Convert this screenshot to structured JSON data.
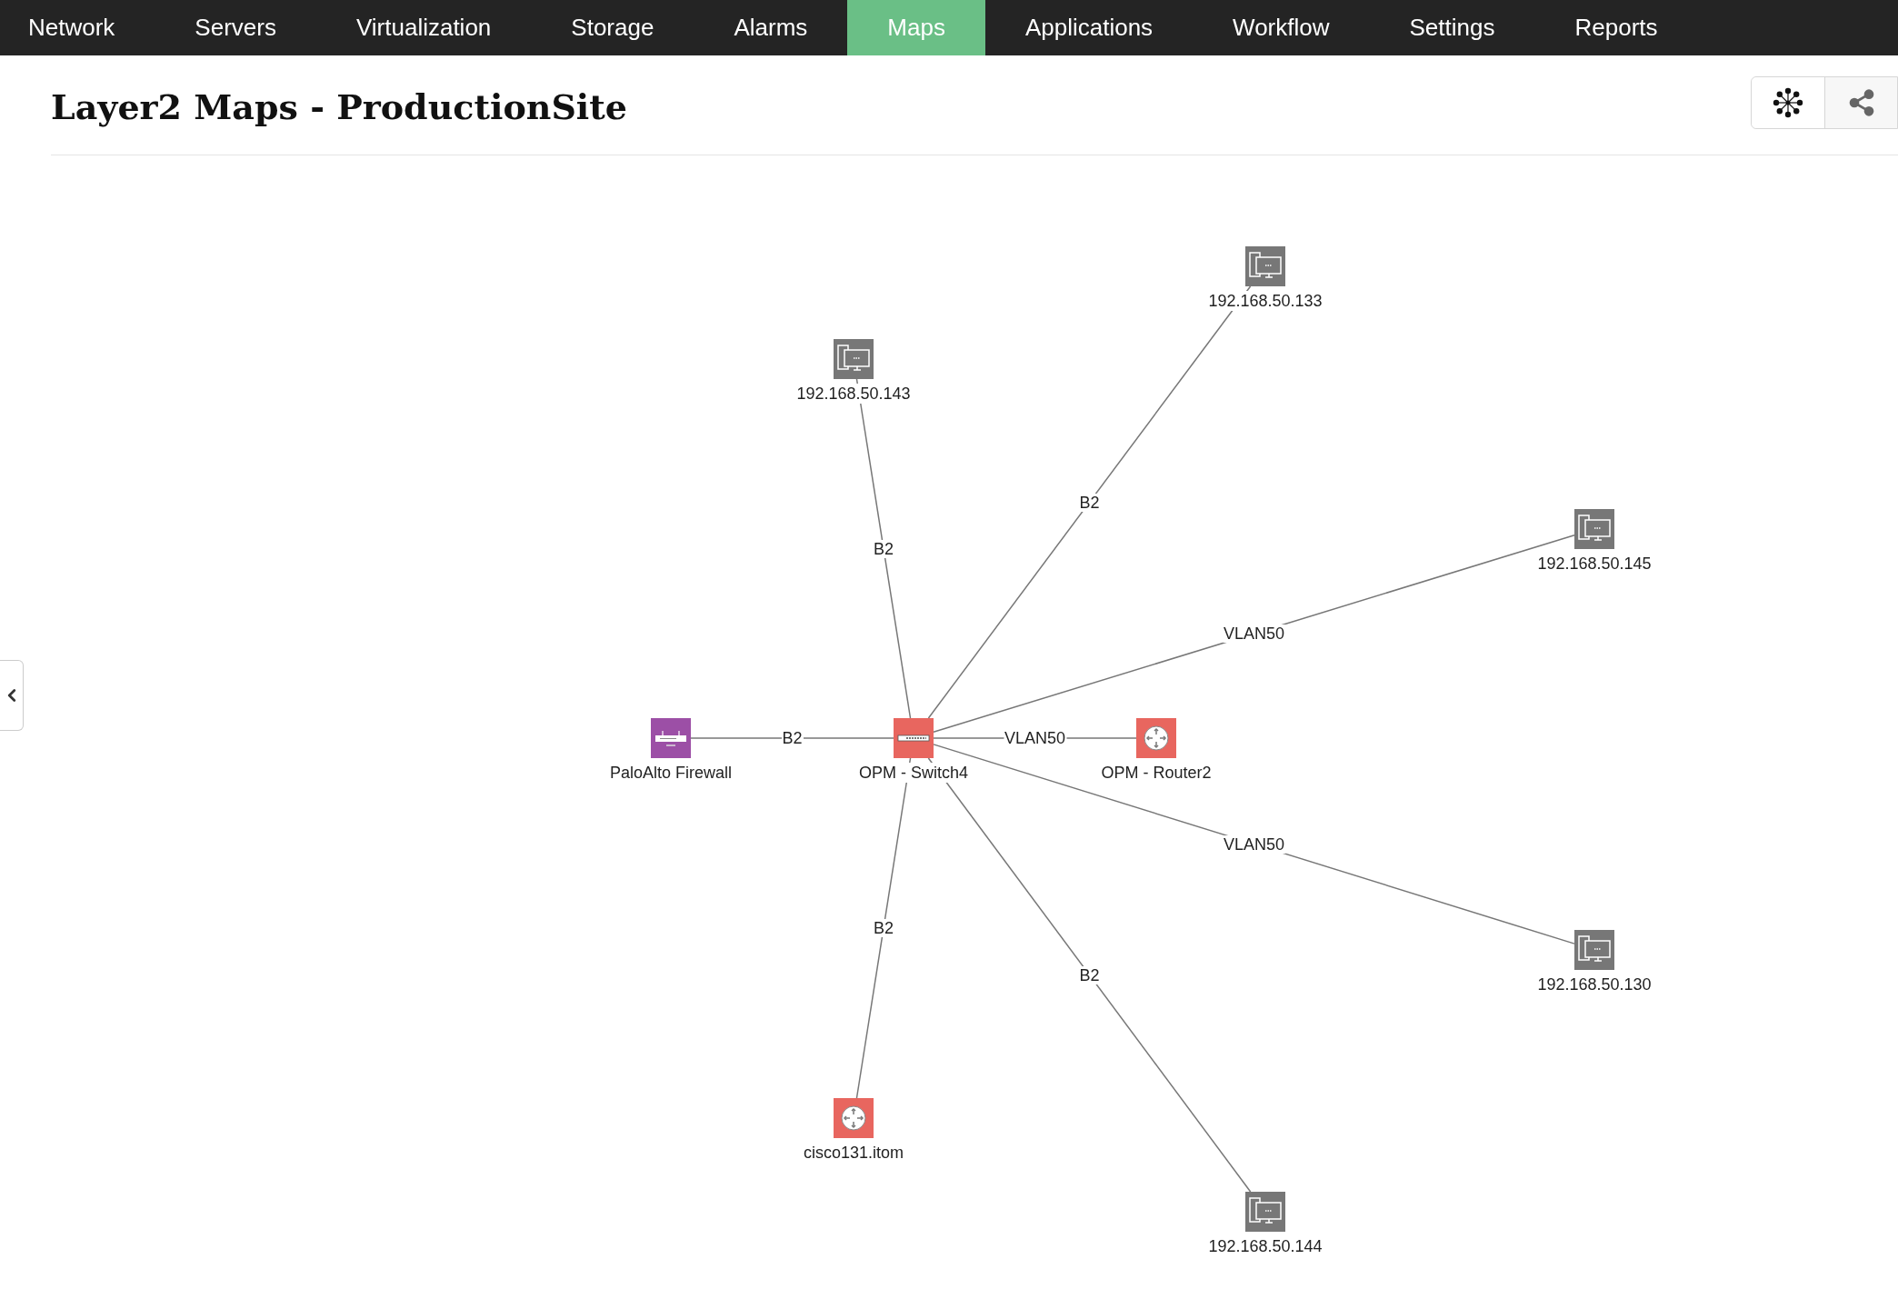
{
  "nav": [
    {
      "label": "Network",
      "selected": false
    },
    {
      "label": "Servers",
      "selected": false
    },
    {
      "label": "Virtualization",
      "selected": false
    },
    {
      "label": "Storage",
      "selected": false
    },
    {
      "label": "Alarms",
      "selected": false
    },
    {
      "label": "Maps",
      "selected": true
    },
    {
      "label": "Applications",
      "selected": false
    },
    {
      "label": "Workflow",
      "selected": false
    },
    {
      "label": "Settings",
      "selected": false
    },
    {
      "label": "Reports",
      "selected": false
    }
  ],
  "title": "Layer2 Maps - ProductionSite",
  "map": {
    "hub": {
      "label": "OPM - Switch4",
      "kind": "switch"
    },
    "nodes": [
      {
        "label": "PaloAlto Firewall",
        "kind": "firewall",
        "link": "B2"
      },
      {
        "label": "OPM - Router2",
        "kind": "router",
        "link": "VLAN50"
      },
      {
        "label": "192.168.50.143",
        "kind": "desktop",
        "link": "B2"
      },
      {
        "label": "192.168.50.133",
        "kind": "desktop",
        "link": "B2"
      },
      {
        "label": "192.168.50.145",
        "kind": "desktop",
        "link": "VLAN50"
      },
      {
        "label": "192.168.50.130",
        "kind": "desktop",
        "link": "VLAN50"
      },
      {
        "label": "192.168.50.144",
        "kind": "desktop",
        "link": "B2"
      },
      {
        "label": "cisco131.itom",
        "kind": "router",
        "link": "B2"
      }
    ]
  }
}
